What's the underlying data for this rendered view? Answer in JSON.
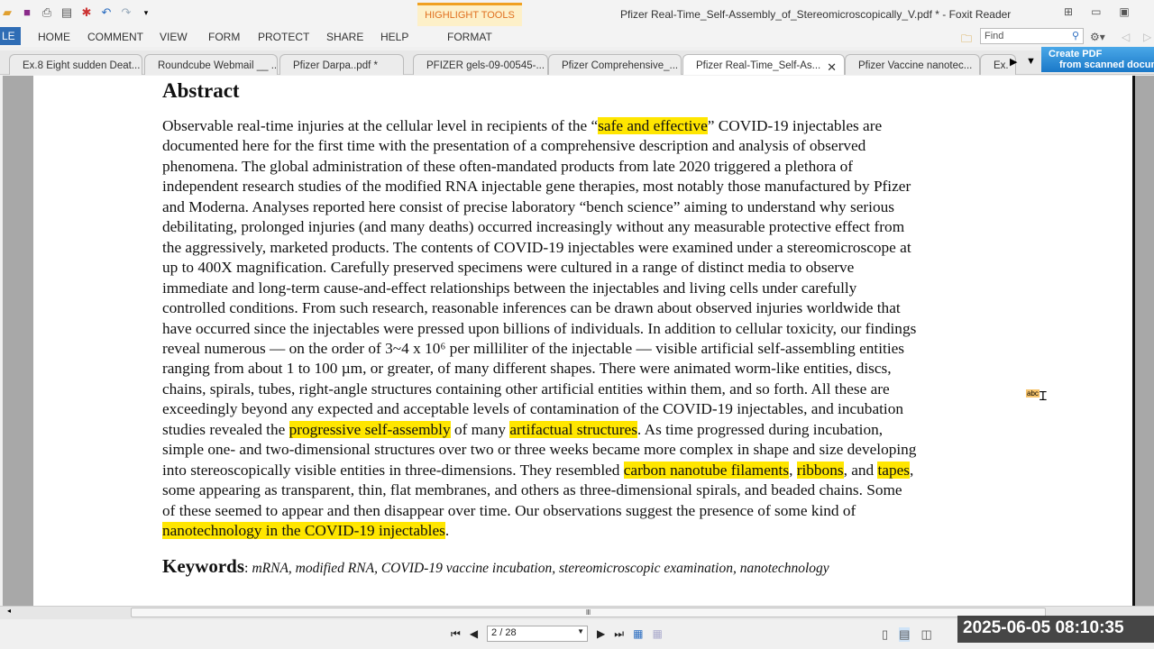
{
  "app": {
    "title": "Pfizer  Real-Time_Self-Assembly_of_Stereomicroscopically_V.pdf * - Foxit Reader",
    "highlight_tools": "HIGHLIGHT TOOLS"
  },
  "ribbon": {
    "file": "LE",
    "tabs": [
      "HOME",
      "COMMENT",
      "VIEW",
      "FORM",
      "PROTECT",
      "SHARE",
      "HELP",
      "FORMAT"
    ],
    "find_placeholder": "Find"
  },
  "doc_tabs": [
    "Ex.8 Eight sudden Deat...",
    "Roundcube Webmail __ ...",
    "Pfizer Darpa..pdf *",
    "PFIZER gels-09-00545-...",
    "Pfizer Comprehensive_...",
    "Pfizer  Real-Time_Self-As...",
    "Pfizer  Vaccine nanotec...",
    "Ex."
  ],
  "active_tab": 5,
  "create_pdf": {
    "line1": "Create PDF",
    "line2": "from scanned docum"
  },
  "document": {
    "heading": "Abstract",
    "lines": [
      [
        {
          "t": "Observable real-time injuries at the cellular level in recipients of the “"
        },
        {
          "t": "safe and effective",
          "hl": true
        },
        {
          "t": "” COVID-19 injectables are"
        }
      ],
      [
        {
          "t": "documented here for the first time with the presentation of a comprehensive description and analysis of observed"
        }
      ],
      [
        {
          "t": "phenomena. The global administration of these often-mandated products from late 2020 triggered a plethora of"
        }
      ],
      [
        {
          "t": "independent research studies of the modified RNA injectable gene therapies, most notably those manufactured by Pfizer"
        }
      ],
      [
        {
          "t": "and Moderna. Analyses reported here consist of precise laboratory “bench science” aiming to understand why serious"
        }
      ],
      [
        {
          "t": "debilitating, prolonged injuries (and many deaths) occurred increasingly without any measurable protective effect from"
        }
      ],
      [
        {
          "t": "the aggressively, marketed products. The contents of COVID-19 injectables were examined under a stereomicroscope at"
        }
      ],
      [
        {
          "t": "up to 400X magnification. Carefully preserved specimens were cultured in a range of distinct media to observe"
        }
      ],
      [
        {
          "t": "immediate and long-term cause-and-effect relationships between the injectables and living cells under carefully"
        }
      ],
      [
        {
          "t": "controlled conditions. From such research, reasonable inferences can be drawn about observed injuries worldwide that"
        }
      ],
      [
        {
          "t": "have occurred since the injectables were pressed upon billions of individuals. In addition to cellular toxicity, our findings"
        }
      ],
      [
        {
          "t": "reveal numerous — on the order of 3~4 x 10⁶ per milliliter of the injectable — visible artificial self-assembling entities"
        }
      ],
      [
        {
          "t": "ranging from about 1 to 100 µm, or greater, of many different shapes. There were animated worm-like entities, discs,"
        }
      ],
      [
        {
          "t": "chains, spirals, tubes, right-angle structures containing other artificial entities within them, and so forth. All these are"
        }
      ],
      [
        {
          "t": "exceedingly beyond any expected and acceptable levels of contamination of the COVID-19 injectables, and incubation"
        }
      ],
      [
        {
          "t": "studies revealed the "
        },
        {
          "t": "progressive self-assembly",
          "hl": true
        },
        {
          "t": " of many "
        },
        {
          "t": "artifactual structures",
          "hl": true
        },
        {
          "t": ". As time progressed during incubation,"
        }
      ],
      [
        {
          "t": "simple one- and two-dimensional structures over two or three weeks became more complex in shape and size developing"
        }
      ],
      [
        {
          "t": "into stereoscopically visible entities in three-dimensions. They resembled "
        },
        {
          "t": "carbon nanotube filaments",
          "hl": true
        },
        {
          "t": ", "
        },
        {
          "t": "ribbons",
          "hl": true
        },
        {
          "t": ", and "
        },
        {
          "t": "tapes",
          "hl": true
        },
        {
          "t": ","
        }
      ],
      [
        {
          "t": "some appearing as transparent, thin, flat membranes, and others as three-dimensional spirals, and beaded chains. Some"
        }
      ],
      [
        {
          "t": "of these seemed to appear and then disappear over time. Our observations suggest the presence of some kind of"
        }
      ],
      [
        {
          "t": "nanotechnology in the COVID-19 injectables",
          "hl": true
        },
        {
          "t": "."
        }
      ]
    ],
    "keywords_label": "Keywords",
    "keywords": "mRNA, modified RNA, COVID-19 vaccine incubation, stereomicroscopic examination, nanotechnology",
    "cursor_label": "abc"
  },
  "highlight_color": "#ffe600",
  "status": {
    "page": "2 / 28",
    "timestamp": "2025-06-05  08:10:35"
  }
}
